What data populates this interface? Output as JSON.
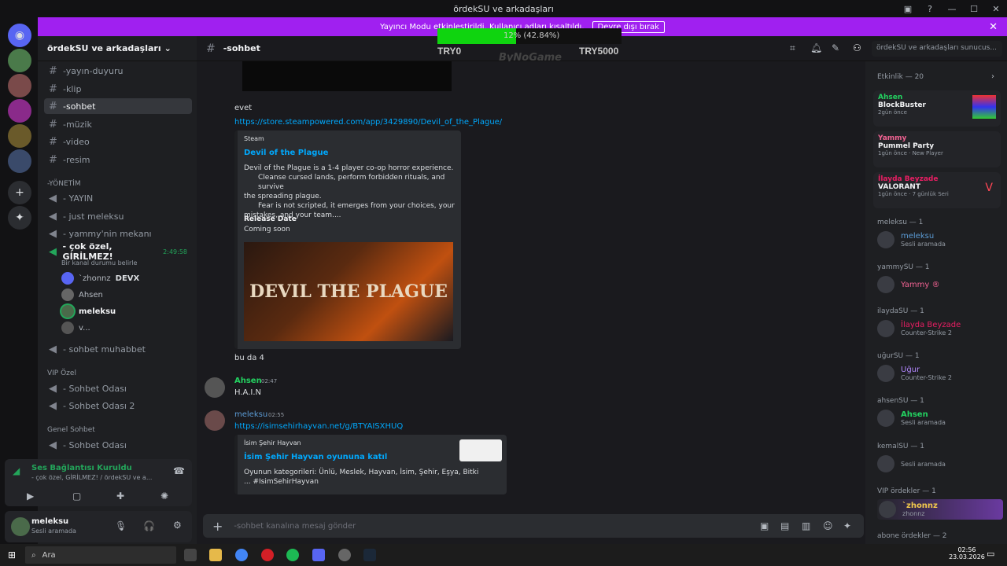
{
  "window": {
    "title": "ördekSU ve arkadaşları"
  },
  "banner": {
    "text": "Yayıncı Modu etkinleştirildi. Kullanıcı adları kısaltıldı.",
    "button": "Devre dışı bırak"
  },
  "overlay": {
    "progress_text": "12% (42.84%)",
    "progress": 0.4284,
    "left_label": "TRY0",
    "right_label": "TRY5000",
    "brand": "ByNoGame"
  },
  "server": {
    "name": "ördekSU ve arkadaşları"
  },
  "channels": [
    {
      "label": "-yayın-duyuru"
    },
    {
      "label": "-klip"
    },
    {
      "label": "-sohbet"
    },
    {
      "label": "-müzik"
    },
    {
      "label": "-video"
    },
    {
      "label": "-resim"
    }
  ],
  "category_yonetim": "-YÖNETİM",
  "voice_channels": [
    {
      "label": "- YAYIN"
    },
    {
      "label": "- just meleksu"
    },
    {
      "label": "- yammy'nin mekanı"
    },
    {
      "label": "- çok özel, GİRİLMEZ!",
      "timer": "2:49:58",
      "sub": "Bir kanal durumu belirle"
    }
  ],
  "voice_users": [
    {
      "name": "`zhonnz",
      "tag": "DEVX"
    },
    {
      "name": "Ahsen"
    },
    {
      "name": "meleksu"
    },
    {
      "name": "v..."
    }
  ],
  "more_channels": [
    {
      "label": "- sohbet muhabbet"
    }
  ],
  "category_vip": "VIP Özel",
  "vip_channels": [
    {
      "label": "- Sohbet Odası"
    },
    {
      "label": "- Sohbet Odası 2"
    }
  ],
  "category_genel": "Genel Sohbet",
  "genel_channels": [
    {
      "label": "- Sohbet Odası"
    }
  ],
  "voice_panel": {
    "status": "Ses Bağlantısı Kuruldu",
    "sub": "- çok özel, GİRİLMEZ! / ördekSU ve a..."
  },
  "user_panel": {
    "name": "meleksu",
    "status": "Sesli aramada"
  },
  "channel_header": {
    "name": "-sohbet",
    "search_placeholder": "ördekSU ve arkadaşları sunucus..."
  },
  "messages": {
    "evet": "evet",
    "steam_link": "https://store.steampowered.com/app/3429890/Devil_of_the_Plague/",
    "steam_embed": {
      "provider": "Steam",
      "title": "Devil of the Plague",
      "desc1": "Devil of the Plague is a 1-4 player co-op horror experience.",
      "desc2": "Cleanse cursed lands, perform forbidden rituals, and survive",
      "desc3": "the spreading plague.",
      "desc4": "Fear is not scripted, it emerges from your choices, your",
      "desc5": "mistakes, and your team....",
      "release_label": "Release Date",
      "release_value": "Coming soon",
      "image_text": "DEVIL THE PLAGUE"
    },
    "bu_da_4": "bu da 4",
    "ahsen_name": "Ahsen",
    "ahsen_time": "02:47",
    "ahsen_text": "H.A.I.N",
    "meleksu_name": "meleksu",
    "meleksu_time": "02:55",
    "isim_link": "https://isimsehirhayvan.net/g/BTYAISXHUQ",
    "isim_embed": {
      "provider": "İsim Şehir Hayvan",
      "title": "İsim Şehir Hayvan oyununa katıl",
      "desc1": "Oyunun kategorileri: Ünlü, Meslek, Hayvan, İsim, Şehir, Eşya, Bitki",
      "desc2": "... #IsimSehirHayvan"
    }
  },
  "composer": {
    "placeholder": "-sohbet kanalına mesaj gönder"
  },
  "members": {
    "activity_header": "Etkinlik — 20",
    "activities": [
      {
        "name": "Ahsen",
        "game": "BlockBuster",
        "time": "2gün önce"
      },
      {
        "name": "Yammy",
        "game": "Pummel Party",
        "time": "1gün önce",
        "extra": "New Player"
      },
      {
        "name": "İlayda Beyzade",
        "game": "VALORANT",
        "time": "1gün önce",
        "extra": "7 günlük Seri"
      }
    ],
    "groups": [
      {
        "header": "meleksu — 1",
        "name": "meleksu",
        "status": "Sesli aramada",
        "color": "#5b9bd5"
      },
      {
        "header": "yammySU — 1",
        "name": "Yammy ®",
        "status": "",
        "color": "#f06292"
      },
      {
        "header": "ilaydaSU — 1",
        "name": "İlayda Beyzade",
        "status": "Counter-Strike 2",
        "color": "#e91e63"
      },
      {
        "header": "uğurSU — 1",
        "name": "Uğur",
        "status": "Counter-Strike 2",
        "color": "#b388ff"
      },
      {
        "header": "ahsenSU — 1",
        "name": "Ahsen",
        "status": "Sesli aramada",
        "color": "#23d160"
      },
      {
        "header": "kemalSU — 1",
        "name": "",
        "status": "Sesli aramada",
        "color": "#dbdee1"
      },
      {
        "header": "VIP ördekler — 1",
        "name": "`zhonnz",
        "status": "zhonnz",
        "color": "#f2c94c"
      }
    ],
    "last_header": "abone ördekler — 2"
  },
  "taskbar": {
    "search": "Ara",
    "time": "02:56",
    "date": "23.03.2026"
  }
}
